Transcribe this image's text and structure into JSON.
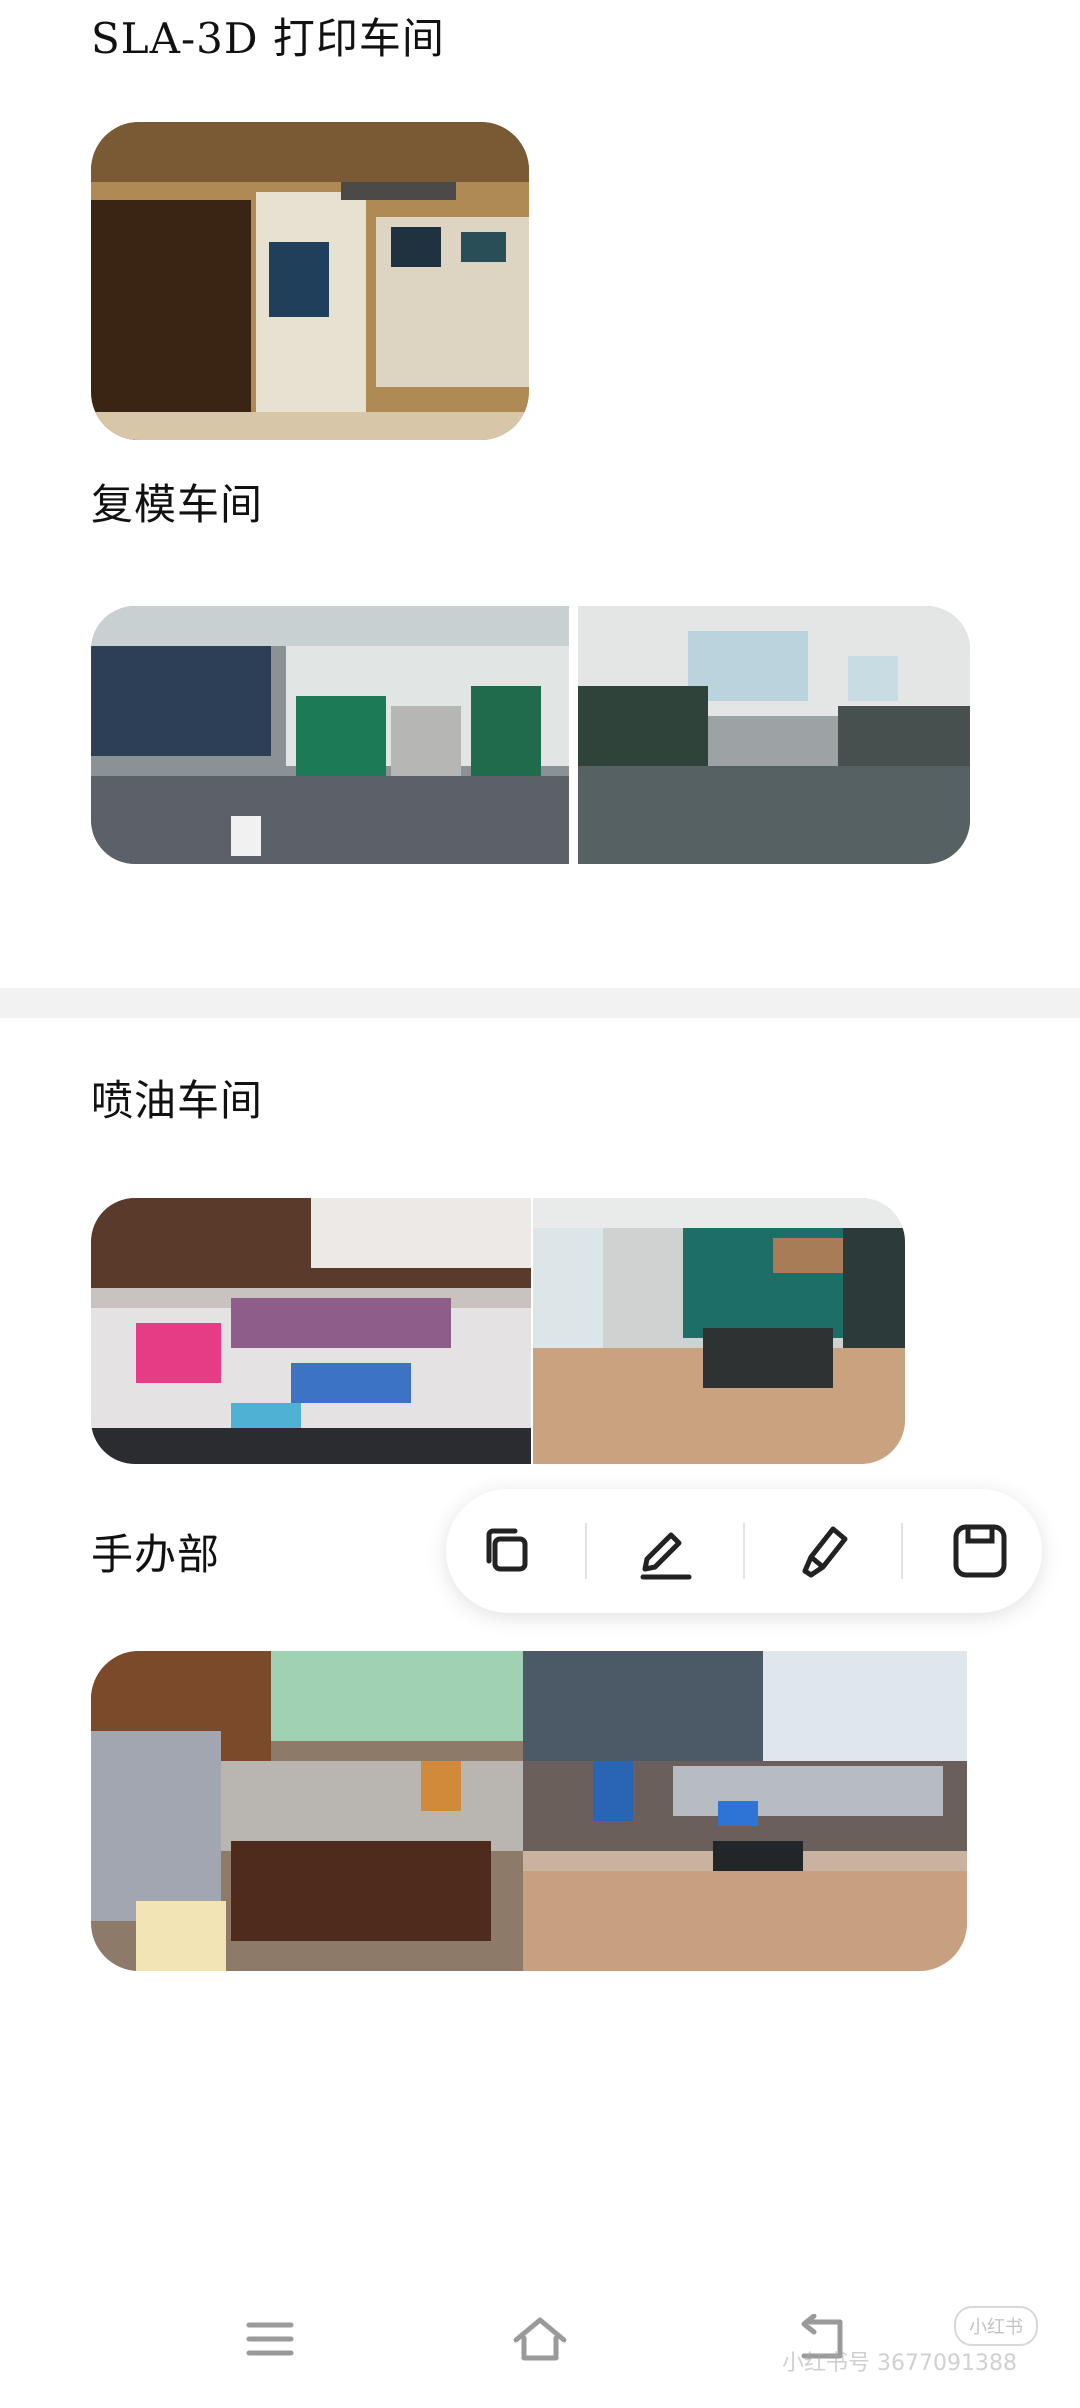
{
  "sections": {
    "sla": {
      "title": "SLA-3D 打印车间"
    },
    "mold": {
      "title": "复模车间"
    },
    "paint": {
      "title": "喷油车间"
    },
    "figure": {
      "title": "手办部"
    }
  },
  "toolbar": {
    "icons": [
      "copy-icon",
      "edit-icon",
      "highlight-icon",
      "save-icon"
    ]
  },
  "navbar": {
    "icons": [
      "menu-icon",
      "home-icon",
      "back-icon"
    ]
  },
  "watermark": {
    "badge": "小红书",
    "text": "小红书号 3677091388"
  },
  "colors": {
    "background": "#ffffff",
    "divider": "#f2f2f2",
    "text": "#111111",
    "icon": "#222222"
  }
}
